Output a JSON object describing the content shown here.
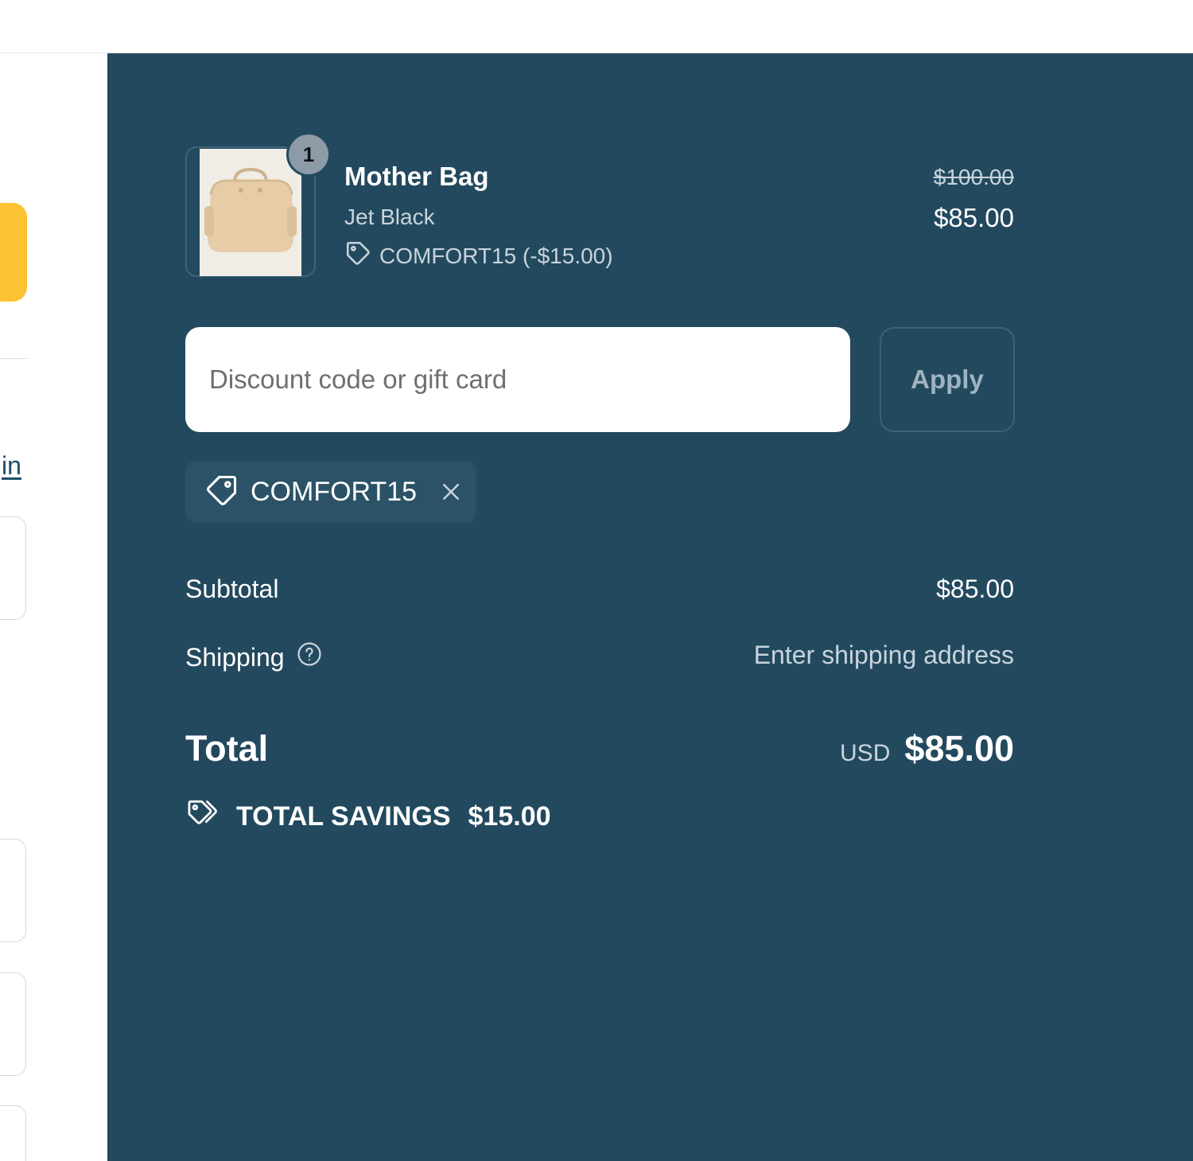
{
  "product": {
    "name": "Mother Bag",
    "variant": "Jet Black",
    "quantity": "1",
    "discount_line": "COMFORT15 (-$15.00)",
    "original_price": "$100.00",
    "price": "$85.00",
    "image_icon": "tote-bag-image"
  },
  "discount": {
    "placeholder": "Discount code or gift card",
    "apply_label": "Apply",
    "applied_code": "COMFORT15"
  },
  "summary": {
    "subtotal_label": "Subtotal",
    "subtotal_value": "$85.00",
    "shipping_label": "Shipping",
    "shipping_value": "Enter shipping address",
    "total_label": "Total",
    "currency": "USD",
    "total_value": "$85.00",
    "savings_label": "TOTAL SAVINGS",
    "savings_value": "$15.00"
  },
  "left_pane": {
    "link_text": "in"
  },
  "colors": {
    "summary_bg": "#23495e",
    "accent_yellow": "#fdc134",
    "muted_text": "#c8d4dc"
  }
}
